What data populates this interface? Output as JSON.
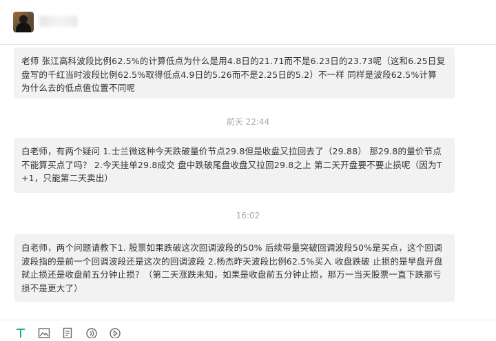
{
  "header": {
    "avatar_icon": "user-avatar",
    "contact_name": ""
  },
  "messages": [
    {
      "text": "老师 张江高科波段比例62.5%的计算低点为什么是用4.8日的21.71而不是6.23日的23.73呢（这和6.25日复盘写的千红当时波段比例62.5%取得低点4.9日的5.26而不是2.25日的5.2）不一样  同样是波段62.5%计算 为什么去的低点值位置不同呢"
    },
    {
      "text": "白老师，有两个疑问 1.士兰微这种今天跌破量价节点29.8但是收盘又拉回去了（29.88） 那29.8的量价节点不能算买点了吗？ 2.今天挂单29.8成交 盘中跌破尾盘收盘又拉回29.8之上 第二天开盘要不要止损呢（因为T+1，只能第二天卖出）"
    },
    {
      "text": "白老师，两个问题请教下1. 股票如果跌破这次回调波段的50% 后续带量突破回调波段50%是买点，这个回调波段指的是前一个回调波段还是这次的回调波段  2.杨杰昨天波段比例62.5%买入 收盘跌破 止损的是早盘开盘就止损还是收盘前五分钟止损？（第二天涨跌未知，如果是收盘前五分钟止损，那万一当天股票一直下跌那亏损不是更大了）"
    }
  ],
  "timestamps": [
    "前天 22:44",
    "16:02"
  ],
  "toolbar": {
    "icons": [
      "text-format-icon",
      "image-icon",
      "document-icon",
      "audio-icon",
      "video-icon"
    ],
    "accent_color": "#1aad8f"
  }
}
